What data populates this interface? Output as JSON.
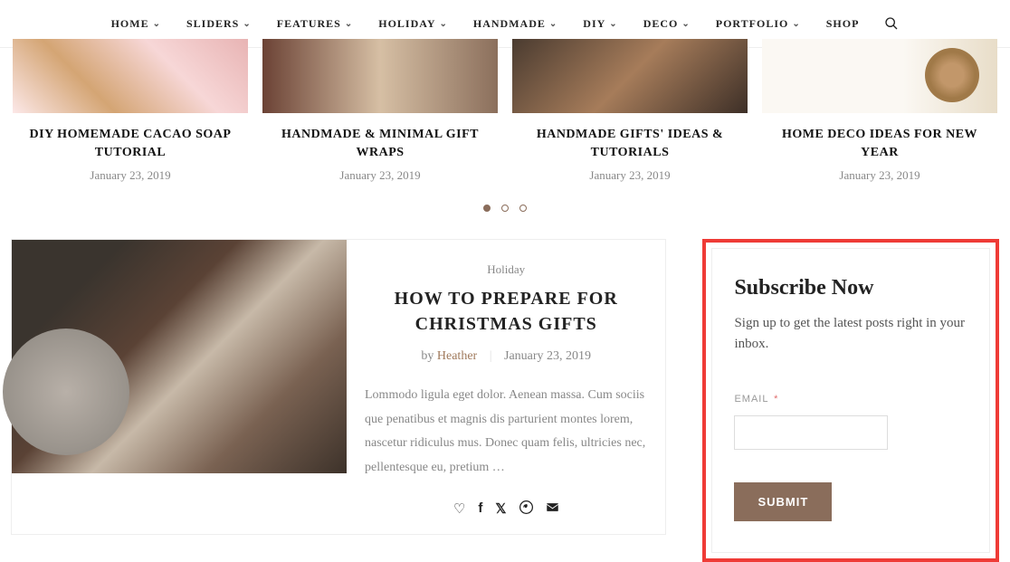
{
  "nav": {
    "items": [
      {
        "label": "HOME"
      },
      {
        "label": "SLIDERS"
      },
      {
        "label": "FEATURES"
      },
      {
        "label": "HOLIDAY"
      },
      {
        "label": "HANDMADE"
      },
      {
        "label": "DIY"
      },
      {
        "label": "DECO"
      },
      {
        "label": "PORTFOLIO"
      }
    ],
    "shop": "SHOP"
  },
  "carousel": {
    "cards": [
      {
        "title": "DIY HOMEMADE CACAO SOAP TUTORIAL",
        "date": "January 23, 2019"
      },
      {
        "title": "HANDMADE & MINIMAL GIFT WRAPS",
        "date": "January 23, 2019"
      },
      {
        "title": "HANDMADE GIFTS' IDEAS & TUTORIALS",
        "date": "January 23, 2019"
      },
      {
        "title": "HOME DECO IDEAS FOR NEW YEAR",
        "date": "January 23, 2019"
      }
    ],
    "active_dot": 0,
    "dot_count": 3
  },
  "post": {
    "category": "Holiday",
    "title": "HOW TO PREPARE FOR CHRISTMAS GIFTS",
    "by": "by",
    "author": "Heather",
    "date": "January 23, 2019",
    "excerpt": "Lommodo ligula eget dolor. Aenean massa. Cum sociis que penatibus et magnis dis parturient montes lorem, nascetur ridiculus mus. Donec quam felis, ultricies nec, pellentesque eu, pretium …"
  },
  "subscribe": {
    "heading": "Subscribe Now",
    "text": "Sign up to get the latest posts right in your inbox.",
    "email_label": "EMAIL",
    "required": "*",
    "submit": "SUBMIT"
  }
}
